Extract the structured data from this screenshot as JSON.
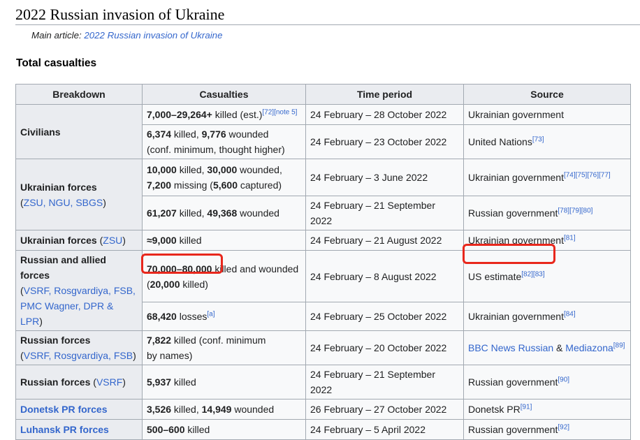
{
  "heading": "2022 Russian invasion of Ukraine",
  "hatnote": {
    "prefix": "Main article: ",
    "link": "2022 Russian invasion of Ukraine"
  },
  "subheading": "Total casualties",
  "table": {
    "headers": [
      "Breakdown",
      "Casualties",
      "Time period",
      "Source"
    ],
    "civilians_label": "Civilians",
    "ukr_forces_label": "Ukrainian forces",
    "ukr_forces_sub": "ZSU, NGU, SBGS",
    "ukr_zsu_label": "Ukrainian forces",
    "ukr_zsu_sub": "ZSU",
    "ru_allied_label": "Russian and allied forces",
    "ru_allied_sub": "VSRF, Rosgvardiya, FSB, PMC Wagner, DPR & LPR",
    "ru_forces_label": "Russian forces",
    "ru_forces_sub": "VSRF, Rosgvardiya, FSB",
    "ru_vsrf_label": "Russian forces",
    "ru_vsrf_sub": "VSRF",
    "donetsk_label": "Donetsk PR forces",
    "luhansk_label": "Luhansk PR forces",
    "rows": [
      {
        "cas_bold1": "7,000–29,264+",
        "cas_text1": " killed (est.)",
        "cas_refs": "[72][note 5]",
        "period": "24 February – 28 October 2022",
        "source": "Ukrainian government",
        "source_refs": ""
      },
      {
        "cas_bold1": "6,374",
        "cas_text1": " killed, ",
        "cas_bold2": "9,776",
        "cas_text2": " wounded",
        "cas_line2": "(conf. minimum, thought higher)",
        "period": "24 February – 23 October 2022",
        "source": "United Nations",
        "source_refs": "[73]"
      },
      {
        "cas_bold1": "10,000",
        "cas_text1": " killed, ",
        "cas_bold2": "30,000",
        "cas_text2": " wounded,",
        "cas_bold3": "7,200",
        "cas_text3": " missing (",
        "cas_bold4": "5,600",
        "cas_text4": " captured)",
        "period": "24 February – 3 June 2022",
        "source": "Ukrainian government",
        "source_refs": "[74][75][76][77]"
      },
      {
        "cas_bold1": "61,207",
        "cas_text1": " killed, ",
        "cas_bold2": "49,368",
        "cas_text2": " wounded",
        "period": "24 February – 21 September 2022",
        "source": "Russian government",
        "source_refs": "[78][79][80]"
      },
      {
        "cas_bold1": "≈9,000",
        "cas_text1": " killed",
        "period": "24 February – 21 August 2022",
        "source": "Ukrainian government",
        "source_refs": "[81]"
      },
      {
        "cas_bold1": "70,000–80,000",
        "cas_text1": " killed and wounded",
        "cas_open": "(",
        "cas_bold2": "20,000",
        "cas_text2": " killed)",
        "period": "24 February – 8 August 2022",
        "source": "US estimate",
        "source_refs": "[82][83]"
      },
      {
        "cas_bold1": "68,420",
        "cas_text1": " losses",
        "cas_refs": "[a]",
        "period": "24 February – 25 October 2022",
        "source": "Ukrainian government",
        "source_refs": "[84]"
      },
      {
        "cas_bold1": "7,822",
        "cas_text1": " killed (conf. minimum",
        "cas_line2": "by names)",
        "period": "24 February – 20 October 2022",
        "source_link1": "BBC News Russian",
        "source_amp": " & ",
        "source_link2": "Mediazona",
        "source_refs": "[89]"
      },
      {
        "cas_bold1": "5,937",
        "cas_text1": " killed",
        "period": "24 February – 21 September 2022",
        "source": "Russian government",
        "source_refs": "[90]"
      },
      {
        "cas_bold1": "3,526",
        "cas_text1": " killed, ",
        "cas_bold2": "14,949",
        "cas_text2": " wounded",
        "period": "26 February – 27 October 2022",
        "source": "Donetsk PR",
        "source_refs": "[91]"
      },
      {
        "cas_bold1": "500–600",
        "cas_text1": " killed",
        "period": "24 February – 5 April 2022",
        "source": "Russian government",
        "source_refs": "[92]"
      }
    ]
  },
  "colors": {
    "link": "#3366cc",
    "highlight": "#e8271c",
    "header_bg": "#eaecf0",
    "cell_bg": "#f8f9fa",
    "border": "#a2a9b1"
  }
}
